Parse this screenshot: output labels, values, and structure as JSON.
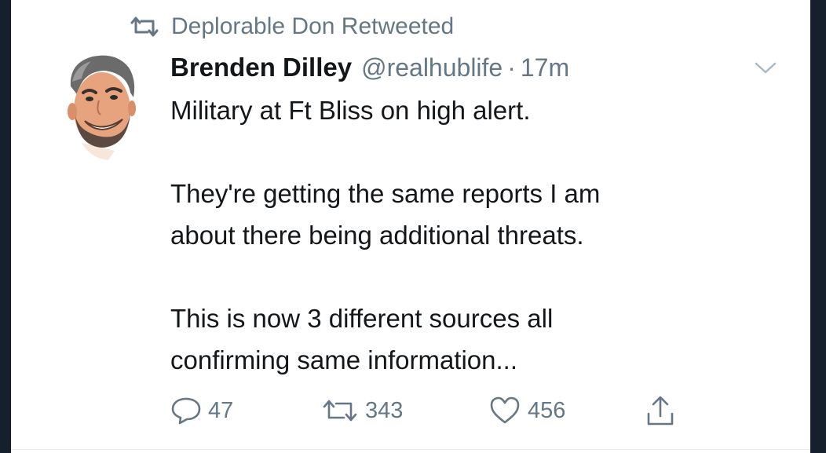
{
  "social_context": {
    "icon": "retweet-icon",
    "text": "Deplorable Don Retweeted"
  },
  "tweet": {
    "author": {
      "display_name": "Brenden Dilley",
      "handle": "@realhublife",
      "avatar": "cartoon-avatar"
    },
    "separator": "·",
    "timestamp": "17m",
    "paragraphs": [
      [
        "Military at Ft Bliss on high alert."
      ],
      [
        "They're getting the same reports I am",
        "about there being additional threats."
      ],
      [
        "This is now 3 different sources all",
        "confirming same information..."
      ]
    ],
    "menu_icon": "chevron-down-icon",
    "actions": {
      "reply": {
        "icon": "reply-icon",
        "count": "47"
      },
      "retweet": {
        "icon": "retweet-icon",
        "count": "343"
      },
      "like": {
        "icon": "heart-icon",
        "count": "456"
      },
      "share": {
        "icon": "share-icon"
      }
    }
  },
  "colors": {
    "background": "#16202c",
    "card": "#ffffff",
    "text_primary": "#14171a",
    "text_secondary": "#657786"
  }
}
